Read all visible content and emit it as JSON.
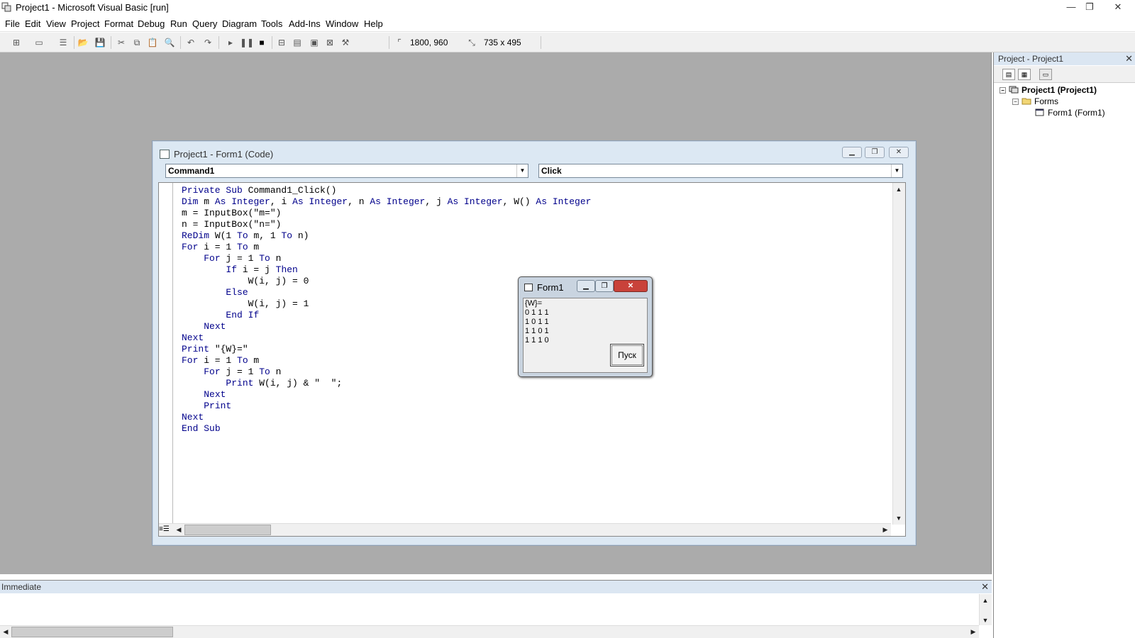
{
  "window": {
    "title": "Project1 - Microsoft Visual Basic [run]",
    "minimize": "—",
    "maximize": "❐",
    "close": "✕"
  },
  "menu": [
    "File",
    "Edit",
    "View",
    "Project",
    "Format",
    "Debug",
    "Run",
    "Query",
    "Diagram",
    "Tools",
    "Add-Ins",
    "Window",
    "Help"
  ],
  "toolbar": {
    "position": "1800, 960",
    "size": "735 x 495"
  },
  "code_window": {
    "title": "Project1 - Form1 (Code)",
    "object_combo": "Command1",
    "procedure_combo": "Click",
    "lines": [
      "Private Sub Command1_Click()",
      "Dim m As Integer, i As Integer, n As Integer, j As Integer, W() As Integer",
      "m = InputBox(\"m=\")",
      "n = InputBox(\"n=\")",
      "ReDim W(1 To m, 1 To n)",
      "For i = 1 To m",
      "    For j = 1 To n",
      "        If i = j Then",
      "            W(i, j) = 0",
      "        Else",
      "            W(i, j) = 1",
      "        End If",
      "    Next",
      "Next",
      "Print \"{W}=\"",
      "For i = 1 To m",
      "    For j = 1 To n",
      "        Print W(i, j) & \"  \";",
      "    Next",
      "    Print",
      "Next",
      "End Sub"
    ]
  },
  "form1": {
    "title": "Form1",
    "output": "{W}=\n0 1 1 1\n1 0 1 1\n1 1 0 1\n1 1 1 0",
    "button_label": "Пуск"
  },
  "project_explorer": {
    "title": "Project - Project1",
    "project": "Project1 (Project1)",
    "folder": "Forms",
    "form": "Form1 (Form1)"
  },
  "immediate": {
    "title": "Immediate"
  }
}
